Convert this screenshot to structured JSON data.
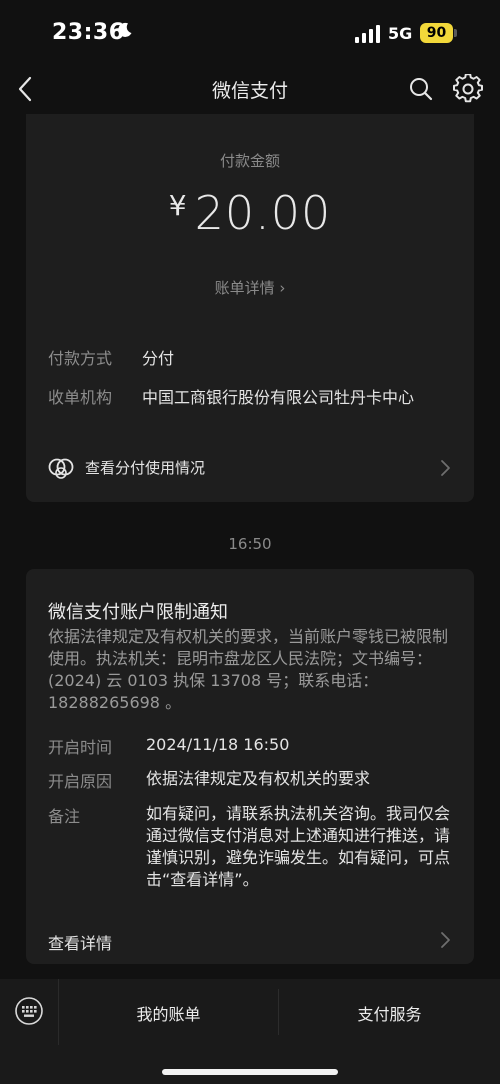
{
  "status_bar": {
    "time": "23:36",
    "network": "5G",
    "battery": "90",
    "battery_color": "#f2d83a"
  },
  "nav": {
    "title": "微信支付",
    "icons": [
      "back-icon",
      "search-icon",
      "gear-icon"
    ]
  },
  "payment": {
    "amount_label": "付款金额",
    "currency": "¥",
    "amount": "20.00",
    "bill_detail_link": "账单详情 ›",
    "method_label": "付款方式",
    "method_value": "分付",
    "org_label": "收单机构",
    "org_value": "中国工商银行股份有限公司牡丹卡中心",
    "usage_label": "查看分付使用情况"
  },
  "timestamp": "16:50",
  "notice": {
    "title": "微信支付账户限制通知",
    "body": "依据法律规定及有权机关的要求，当前账户零钱已被限制使用。执法机关：昆明市盘龙区人民法院；文书编号：(2024) 云 0103 执保 13708 号；联系电话：18288265698 。",
    "open_time_label": "开启时间",
    "open_time_value": "2024/11/18 16:50",
    "open_reason_label": "开启原因",
    "open_reason_value": "依据法律规定及有权机关的要求",
    "remark_label": "备注",
    "remark_value": "如有疑问，请联系执法机关咨询。我司仅会通过微信支付消息对上述通知进行推送，请谨慎识别，避免诈骗发生。如有疑问，可点击“查看详情”。",
    "detail_label": "查看详情"
  },
  "bottom_bar": {
    "tab_bills": "我的账单",
    "tab_services": "支付服务"
  }
}
